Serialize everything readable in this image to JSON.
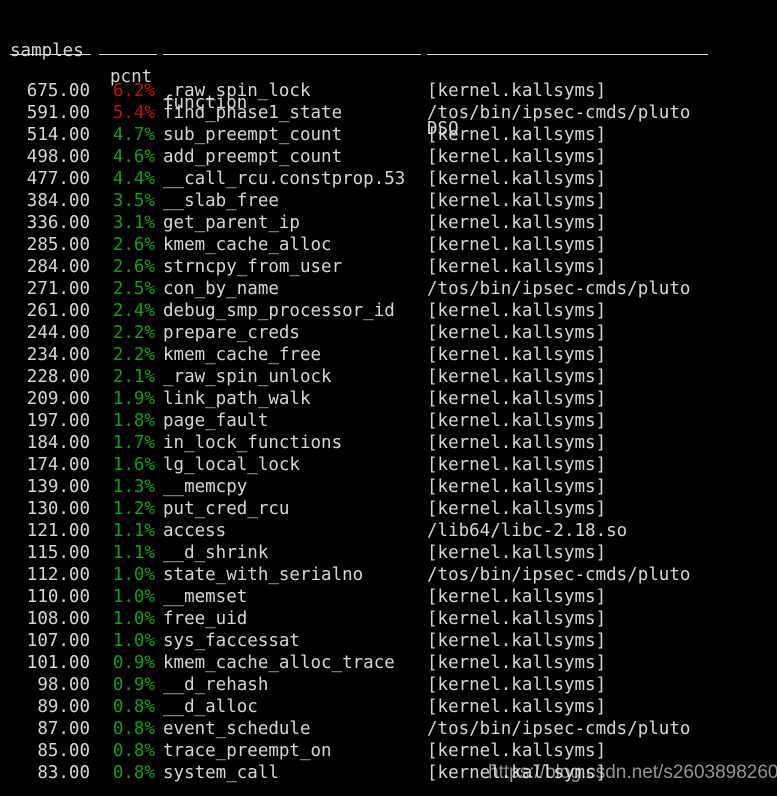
{
  "terminal": {
    "background": "#000000",
    "foreground": "#d6d6d6",
    "pcnt_high_color": "#c21010",
    "pcnt_normal_color": "#12a012"
  },
  "header": {
    "samples": "samples",
    "pcnt": "pcnt",
    "function": "function",
    "dso": "DSO"
  },
  "rows": [
    {
      "samples": "675.00",
      "pcnt": "6.2%",
      "function": "_raw_spin_lock",
      "dso": "[kernel.kallsyms]",
      "hot": true
    },
    {
      "samples": "591.00",
      "pcnt": "5.4%",
      "function": "find_phase1_state",
      "dso": "/tos/bin/ipsec-cmds/pluto",
      "hot": true
    },
    {
      "samples": "514.00",
      "pcnt": "4.7%",
      "function": "sub_preempt_count",
      "dso": "[kernel.kallsyms]",
      "hot": false
    },
    {
      "samples": "498.00",
      "pcnt": "4.6%",
      "function": "add_preempt_count",
      "dso": "[kernel.kallsyms]",
      "hot": false
    },
    {
      "samples": "477.00",
      "pcnt": "4.4%",
      "function": "__call_rcu.constprop.53",
      "dso": "[kernel.kallsyms]",
      "hot": false
    },
    {
      "samples": "384.00",
      "pcnt": "3.5%",
      "function": "__slab_free",
      "dso": "[kernel.kallsyms]",
      "hot": false
    },
    {
      "samples": "336.00",
      "pcnt": "3.1%",
      "function": "get_parent_ip",
      "dso": "[kernel.kallsyms]",
      "hot": false
    },
    {
      "samples": "285.00",
      "pcnt": "2.6%",
      "function": "kmem_cache_alloc",
      "dso": "[kernel.kallsyms]",
      "hot": false
    },
    {
      "samples": "284.00",
      "pcnt": "2.6%",
      "function": "strncpy_from_user",
      "dso": "[kernel.kallsyms]",
      "hot": false
    },
    {
      "samples": "271.00",
      "pcnt": "2.5%",
      "function": "con_by_name",
      "dso": "/tos/bin/ipsec-cmds/pluto",
      "hot": false
    },
    {
      "samples": "261.00",
      "pcnt": "2.4%",
      "function": "debug_smp_processor_id",
      "dso": "[kernel.kallsyms]",
      "hot": false
    },
    {
      "samples": "244.00",
      "pcnt": "2.2%",
      "function": "prepare_creds",
      "dso": "[kernel.kallsyms]",
      "hot": false
    },
    {
      "samples": "234.00",
      "pcnt": "2.2%",
      "function": "kmem_cache_free",
      "dso": "[kernel.kallsyms]",
      "hot": false
    },
    {
      "samples": "228.00",
      "pcnt": "2.1%",
      "function": "_raw_spin_unlock",
      "dso": "[kernel.kallsyms]",
      "hot": false
    },
    {
      "samples": "209.00",
      "pcnt": "1.9%",
      "function": "link_path_walk",
      "dso": "[kernel.kallsyms]",
      "hot": false
    },
    {
      "samples": "197.00",
      "pcnt": "1.8%",
      "function": "page_fault",
      "dso": "[kernel.kallsyms]",
      "hot": false
    },
    {
      "samples": "184.00",
      "pcnt": "1.7%",
      "function": "in_lock_functions",
      "dso": "[kernel.kallsyms]",
      "hot": false
    },
    {
      "samples": "174.00",
      "pcnt": "1.6%",
      "function": "lg_local_lock",
      "dso": "[kernel.kallsyms]",
      "hot": false
    },
    {
      "samples": "139.00",
      "pcnt": "1.3%",
      "function": "__memcpy",
      "dso": "[kernel.kallsyms]",
      "hot": false
    },
    {
      "samples": "130.00",
      "pcnt": "1.2%",
      "function": "put_cred_rcu",
      "dso": "[kernel.kallsyms]",
      "hot": false
    },
    {
      "samples": "121.00",
      "pcnt": "1.1%",
      "function": "access",
      "dso": "/lib64/libc-2.18.so",
      "hot": false
    },
    {
      "samples": "115.00",
      "pcnt": "1.1%",
      "function": "__d_shrink",
      "dso": "[kernel.kallsyms]",
      "hot": false
    },
    {
      "samples": "112.00",
      "pcnt": "1.0%",
      "function": "state_with_serialno",
      "dso": "/tos/bin/ipsec-cmds/pluto",
      "hot": false
    },
    {
      "samples": "110.00",
      "pcnt": "1.0%",
      "function": "__memset",
      "dso": "[kernel.kallsyms]",
      "hot": false
    },
    {
      "samples": "108.00",
      "pcnt": "1.0%",
      "function": "free_uid",
      "dso": "[kernel.kallsyms]",
      "hot": false
    },
    {
      "samples": "107.00",
      "pcnt": "1.0%",
      "function": "sys_faccessat",
      "dso": "[kernel.kallsyms]",
      "hot": false
    },
    {
      "samples": "101.00",
      "pcnt": "0.9%",
      "function": "kmem_cache_alloc_trace",
      "dso": "[kernel.kallsyms]",
      "hot": false
    },
    {
      "samples": "98.00",
      "pcnt": "0.9%",
      "function": "__d_rehash",
      "dso": "[kernel.kallsyms]",
      "hot": false
    },
    {
      "samples": "89.00",
      "pcnt": "0.8%",
      "function": "__d_alloc",
      "dso": "[kernel.kallsyms]",
      "hot": false
    },
    {
      "samples": "87.00",
      "pcnt": "0.8%",
      "function": "event_schedule",
      "dso": "/tos/bin/ipsec-cmds/pluto",
      "hot": false
    },
    {
      "samples": "85.00",
      "pcnt": "0.8%",
      "function": "trace_preempt_on",
      "dso": "[kernel.kallsyms]",
      "hot": false
    },
    {
      "samples": "83.00",
      "pcnt": "0.8%",
      "function": "system_call",
      "dso": "[kernel.kallsyms]",
      "hot": false
    }
  ],
  "watermark": {
    "text": "https://blog.csdn.net/s2603898260"
  }
}
